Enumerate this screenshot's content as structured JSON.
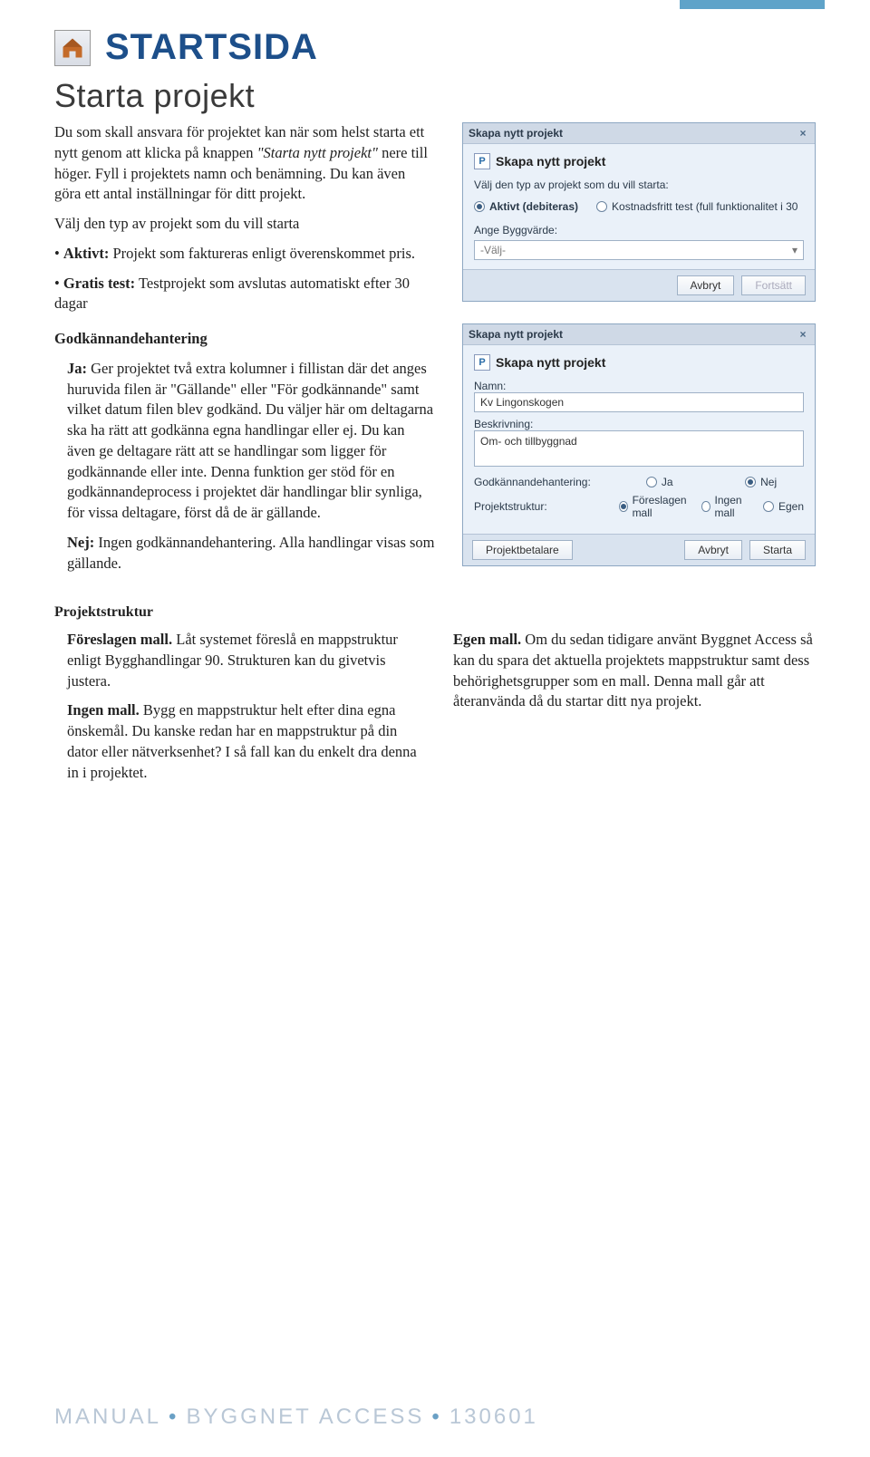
{
  "header": {
    "page_title": "STARTSIDA"
  },
  "section": {
    "title": "Starta projekt"
  },
  "intro": {
    "p1a": "Du som skall ansvara för projektet kan när som helst starta ett nytt genom att klicka på knappen ",
    "p1b": "\"Starta nytt projekt\"",
    "p1c": " nere till höger. Fyll i projektets namn och benämning. Du kan även göra ett antal inställningar för ditt projekt.",
    "p2": "Välj den typ av projekt som du vill starta",
    "b1_label": "Aktivt:",
    "b1_text": " Projekt som faktureras enligt överenskommet pris.",
    "b2_label": "Gratis test:",
    "b2_text": " Testprojekt som avslutas automatiskt efter 30 dagar"
  },
  "godk": {
    "heading": "Godkännandehantering",
    "ja_label": "Ja:",
    "ja_text": " Ger projektet två extra kolumner i fillistan där det anges huruvida filen är \"Gällande\" eller \"För godkännande\" samt vilket datum filen blev godkänd. Du väljer här om deltagarna ska ha rätt att godkänna egna handlingar eller ej. Du kan även ge deltagare rätt att se handlingar som ligger för godkännande eller inte. Denna funktion ger stöd för en godkännandeprocess i projektet där handlingar blir synliga, för vissa deltagare, först då de är gällande.",
    "nej_label": "Nej:",
    "nej_text": " Ingen godkännandehantering. Alla handlingar visas som gällande."
  },
  "struktur": {
    "heading": "Projektstruktur",
    "fm_label": "Föreslagen mall.",
    "fm_text": " Låt systemet föreslå en mappstruktur enligt Bygghandlingar 90. Strukturen kan du givetvis justera.",
    "im_label": "Ingen mall.",
    "im_text": " Bygg en mappstruktur helt efter dina egna önskemål. Du kanske redan har en mappstruktur på din dator eller nätverksenhet? I så fall kan du enkelt dra denna in i projektet.",
    "em_label": "Egen mall.",
    "em_text": " Om du sedan tidigare använt Byggnet Access så kan du spara det aktuella projektets mappstruktur samt dess behörighetsgrupper som en mall. Denna mall går att återanvända då du startar ditt nya projekt."
  },
  "dialog1": {
    "titlebar": "Skapa nytt projekt",
    "inner_title": "Skapa nytt projekt",
    "prompt": "Välj den typ av projekt som du vill starta:",
    "opt_aktivt": "Aktivt (debiteras)",
    "opt_kostnad": "Kostnadsfritt test (full funktionalitet i 30",
    "byggvarde_label": "Ange Byggvärde:",
    "byggvarde_value": "-Välj-",
    "btn_avbryt": "Avbryt",
    "btn_fortsatt": "Fortsätt"
  },
  "dialog2": {
    "titlebar": "Skapa nytt projekt",
    "inner_title": "Skapa nytt projekt",
    "namn_label": "Namn:",
    "namn_value": "Kv Lingonskogen",
    "beskriv_label": "Beskrivning:",
    "beskriv_value": "Om- och tillbyggnad",
    "godk_label": "Godkännandehantering:",
    "godk_ja": "Ja",
    "godk_nej": "Nej",
    "struktur_label": "Projektstruktur:",
    "struktur_fm": "Föreslagen mall",
    "struktur_im": "Ingen mall",
    "struktur_em": "Egen",
    "btn_betalare": "Projektbetalare",
    "btn_avbryt": "Avbryt",
    "btn_starta": "Starta"
  },
  "footer": {
    "a": "MANUAL",
    "b": "BYGGNET ACCESS",
    "c": "130601"
  }
}
